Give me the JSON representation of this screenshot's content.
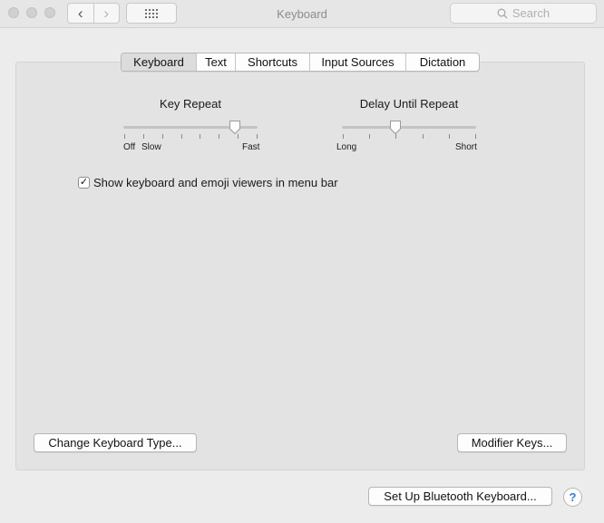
{
  "window": {
    "title": "Keyboard",
    "nav_back": "‹",
    "nav_forward": "›",
    "search_placeholder": "Search"
  },
  "tabs": [
    {
      "label": "Keyboard",
      "active": true
    },
    {
      "label": "Text",
      "active": false
    },
    {
      "label": "Shortcuts",
      "active": false
    },
    {
      "label": "Input Sources",
      "active": false
    },
    {
      "label": "Dictation",
      "active": false
    }
  ],
  "key_repeat": {
    "title": "Key Repeat",
    "label_off": "Off",
    "label_slow": "Slow",
    "label_fast": "Fast",
    "value_fraction": 0.83
  },
  "delay_until_repeat": {
    "title": "Delay Until Repeat",
    "label_long": "Long",
    "label_short": "Short",
    "value_fraction": 0.4
  },
  "show_viewers": {
    "checked": true,
    "check_glyph": "✓",
    "label": "Show keyboard and emoji viewers in menu bar"
  },
  "buttons": {
    "change_keyboard_type": "Change Keyboard Type...",
    "modifier_keys": "Modifier Keys...",
    "bluetooth": "Set Up Bluetooth Keyboard...",
    "help": "?"
  },
  "colors": {
    "help_accent": "#3a7bd5"
  }
}
